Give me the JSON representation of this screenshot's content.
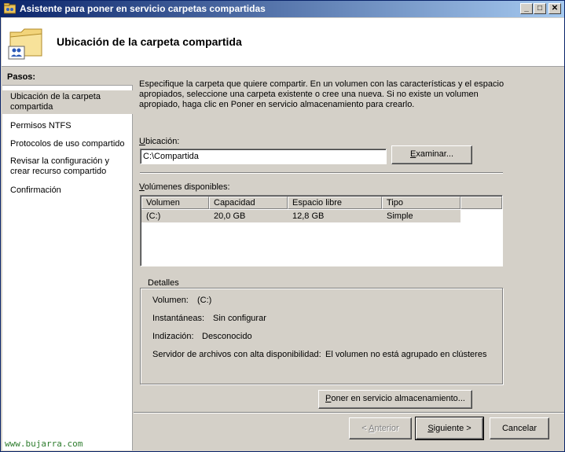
{
  "window": {
    "title": "Asistente para poner en servicio carpetas compartidas",
    "minimize": "_",
    "maximize": "□",
    "close": "✕"
  },
  "header": {
    "title": "Ubicación de la carpeta compartida",
    "icon": "folder-users-icon"
  },
  "sidebar": {
    "heading": "Pasos:",
    "items": [
      {
        "label": "Ubicación de la carpeta compartida",
        "active": true
      },
      {
        "label": "Permisos NTFS",
        "active": false
      },
      {
        "label": "Protocolos de uso compartido",
        "active": false
      },
      {
        "label": "Revisar la configuración y crear recurso compartido",
        "active": false
      },
      {
        "label": "Confirmación",
        "active": false
      }
    ]
  },
  "main": {
    "description": "Especifique la carpeta que quiere compartir. En un volumen con las características y el espacio apropiados, seleccione una carpeta existente o cree una nueva. Si no existe un volumen apropiado, haga clic en Poner en servicio almacenamiento para crearlo.",
    "location_label_u": "U",
    "location_label_rest": "bicación:",
    "location_value": "C:\\Compartida",
    "browse_label_u": "E",
    "browse_label_rest": "xaminar...",
    "volumes_label_u": "V",
    "volumes_label_rest": "olúmenes disponibles:",
    "volumes_columns": [
      "Volumen",
      "Capacidad",
      "Espacio libre",
      "Tipo"
    ],
    "volumes_rows": [
      [
        "(C:)",
        "20,0 GB",
        "12,8 GB",
        "Simple"
      ]
    ],
    "details": {
      "title": "Detalles",
      "volume_label": "Volumen:",
      "volume_value": "(C:)",
      "snapshots_label": "Instantáneas:",
      "snapshots_value": "Sin configurar",
      "indexing_label": "Indización:",
      "indexing_value": "Desconocido",
      "ha_label": "Servidor de archivos con alta disponibilidad:",
      "ha_value": "El volumen no está agrupado en clústeres"
    },
    "provision_u": "P",
    "provision_rest": "oner en servicio almacenamiento..."
  },
  "footer": {
    "back_prefix": "< ",
    "back_u": "A",
    "back_rest": "nterior",
    "next_u": "S",
    "next_rest": "iguiente >",
    "cancel": "Cancelar"
  },
  "watermark": "www.bujarra.com"
}
